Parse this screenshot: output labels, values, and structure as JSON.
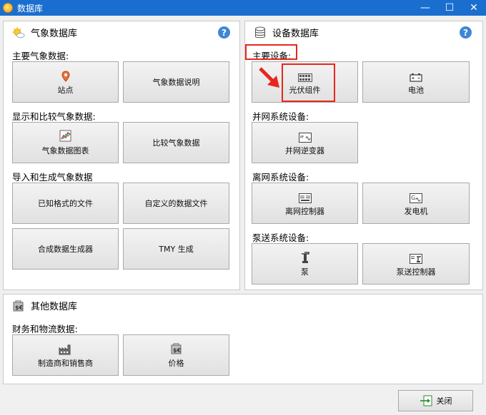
{
  "window": {
    "title": "数据库",
    "minimize": "—",
    "maximize": "☐",
    "close": "✕"
  },
  "help_label": "?",
  "weather": {
    "title": "气象数据库",
    "main_label": "主要气象数据:",
    "station": "站点",
    "station_desc": "气象数据说明",
    "compare_label": "显示和比较气象数据:",
    "chart": "气象数据图表",
    "compare": "比较气象数据",
    "import_label": "导入和生成气象数据",
    "known_format": "已知格式的文件",
    "custom_file": "自定义的数据文件",
    "synth": "合成数据生成器",
    "tmy": "TMY 生成"
  },
  "equipment": {
    "title": "设备数据库",
    "main_label": "主要设备:",
    "pv_module": "光伏组件",
    "battery": "电池",
    "grid_label": "并网系统设备:",
    "inverter": "并网逆变器",
    "offgrid_label": "离网系统设备:",
    "offgrid_controller": "离网控制器",
    "generator": "发电机",
    "pump_label": "泵送系统设备:",
    "pump": "泵",
    "pump_controller": "泵送控制器"
  },
  "other": {
    "title": "其他数据库",
    "finance_label": "财务和物流数据:",
    "manufacturers": "制造商和销售商",
    "prices": "价格"
  },
  "footer": {
    "close_label": "关闭"
  },
  "colors": {
    "titlebar": "#1a6ecf",
    "highlight": "#e8261d",
    "help": "#3f86d6"
  }
}
